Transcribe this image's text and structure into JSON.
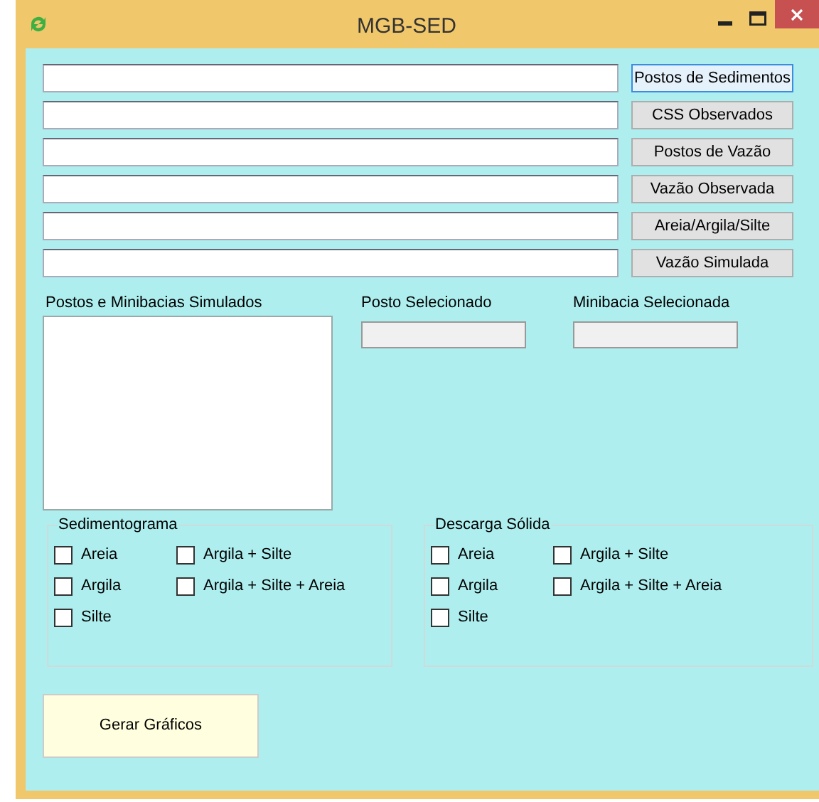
{
  "window": {
    "title": "MGB-SED"
  },
  "file_rows": [
    {
      "button": "Postos de Sedimentos",
      "focused": true
    },
    {
      "button": "CSS Observados",
      "focused": false
    },
    {
      "button": "Postos de Vazão",
      "focused": false
    },
    {
      "button": "Vazão Observada",
      "focused": false
    },
    {
      "button": "Areia/Argila/Silte",
      "focused": false
    },
    {
      "button": "Vazão Simulada",
      "focused": false
    }
  ],
  "list_label": "Postos e Minibacias Simulados",
  "selected_fields": [
    {
      "label": "Posto Selecionado"
    },
    {
      "label": "Minibacia Selecionada"
    }
  ],
  "groups": [
    {
      "title": "Sedimentograma",
      "options": [
        {
          "label": "Areia",
          "checked": false
        },
        {
          "label": "Argila",
          "checked": false
        },
        {
          "label": "Silte",
          "checked": false
        },
        {
          "label": "Argila + Silte",
          "checked": false
        },
        {
          "label": "Argila + Silte + Areia",
          "checked": false
        }
      ]
    },
    {
      "title": "Descarga Sólida",
      "options": [
        {
          "label": "Areia",
          "checked": false
        },
        {
          "label": "Argila",
          "checked": false
        },
        {
          "label": "Silte",
          "checked": false
        },
        {
          "label": "Argila + Silte",
          "checked": false
        },
        {
          "label": "Argila + Silte + Areia",
          "checked": false
        }
      ]
    }
  ],
  "action_button": "Gerar Gráficos"
}
